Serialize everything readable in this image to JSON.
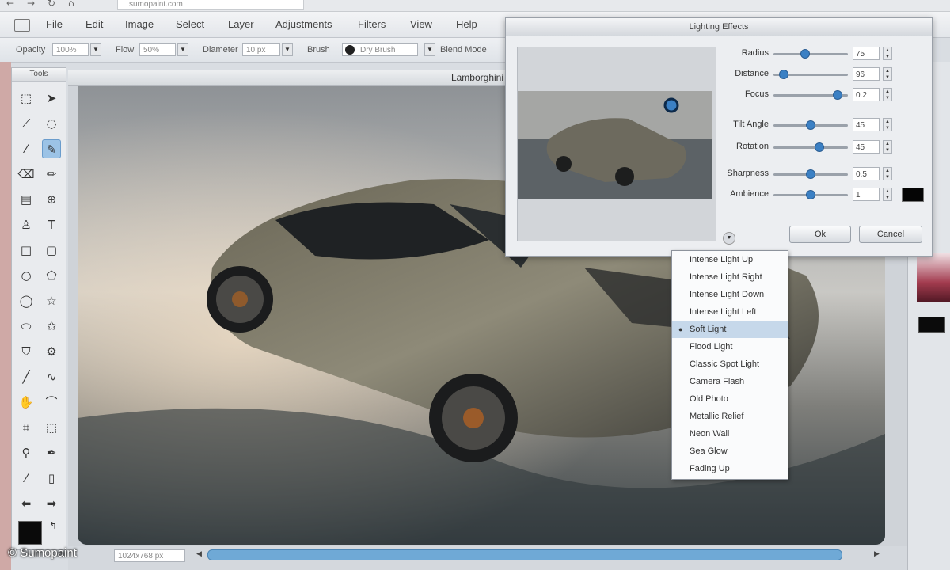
{
  "browser": {
    "url": "sumopaint.com"
  },
  "menubar": {
    "items": [
      "File",
      "Edit",
      "Image",
      "Select",
      "Layer",
      "Adjustments",
      "Filters",
      "View",
      "Help"
    ]
  },
  "options_bar": {
    "opacity_label": "Opacity",
    "opacity_value": "100%",
    "flow_label": "Flow",
    "flow_value": "50%",
    "diameter_label": "Diameter",
    "diameter_value": "10 px",
    "brush_label": "Brush",
    "brush_value": "Dry Brush",
    "blend_label": "Blend Mode"
  },
  "tools_panel": {
    "title": "Tools"
  },
  "document": {
    "title": "Lamborghini",
    "zoom": "1024x768 px"
  },
  "dialog": {
    "title": "Lighting Effects",
    "sliders": [
      {
        "label": "Radius",
        "value": "75",
        "level": 0.42
      },
      {
        "label": "Distance",
        "value": "96",
        "level": 0.08
      },
      {
        "label": "Focus",
        "value": "0.2",
        "level": 0.92
      },
      {
        "label": "Tilt Angle",
        "value": "45",
        "level": 0.5
      },
      {
        "label": "Rotation",
        "value": "45",
        "level": 0.63
      },
      {
        "label": "Sharpness",
        "value": "0.5",
        "level": 0.5
      },
      {
        "label": "Ambience",
        "value": "1",
        "level": 0.5
      }
    ],
    "ok_label": "Ok",
    "cancel_label": "Cancel"
  },
  "preset_menu": {
    "items": [
      "Intense Light Up",
      "Intense Light Right",
      "Intense Light Down",
      "Intense Light Left",
      "Soft Light",
      "Flood Light",
      "Classic Spot Light",
      "Camera Flash",
      "Old Photo",
      "Metallic Relief",
      "Neon Wall",
      "Sea Glow",
      "Fading Up"
    ],
    "selected_index": 4
  },
  "watermark": "© Sumopaint",
  "colors": {
    "accent": "#3b80c4",
    "foreground": "#0a0a0a"
  },
  "icons": [
    "marquee-icon",
    "move-icon",
    "brush-icon",
    "lasso-icon",
    "eyedropper-icon",
    "paint-brush-icon",
    "eraser-icon",
    "pencil-icon",
    "gradient-icon",
    "stamp-icon",
    "dodge-icon",
    "text-icon",
    "rectangle-icon",
    "rounded-rect-icon",
    "ellipse-icon",
    "polygon-icon",
    "star-icon",
    "bucket-icon",
    "gear-icon",
    "line-icon",
    "smudge-icon",
    "hand-icon",
    "crop-icon",
    "zoom-icon",
    "swap-arrows-icon"
  ]
}
